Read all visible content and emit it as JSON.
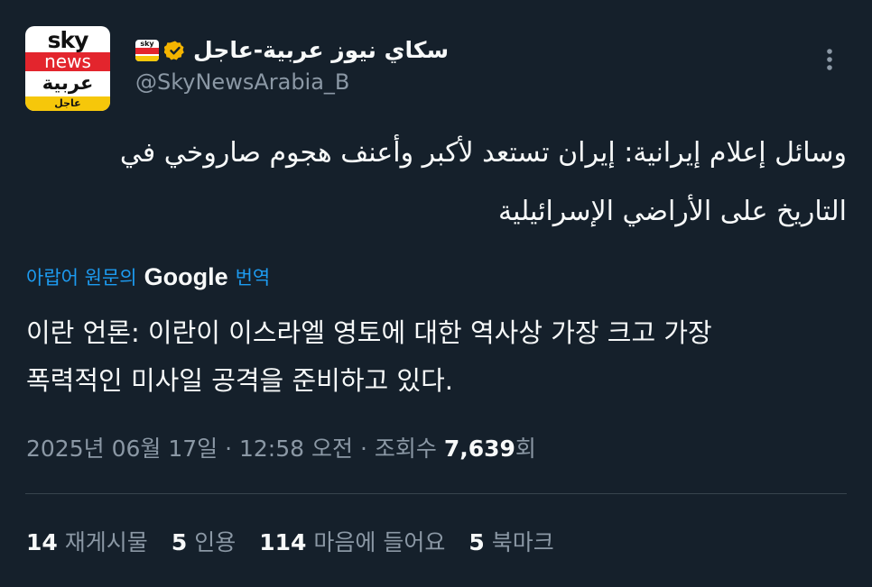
{
  "author": {
    "display_name": "سكاي نيوز عربية-عاجل",
    "handle": "@SkyNewsArabia_B",
    "avatar": {
      "sky": "sky",
      "news": "news",
      "arabic": "عربية",
      "urgent": "عاجل"
    },
    "badge_mini": "sky",
    "verified_icon": "verified-gold-badge-icon",
    "colors": {
      "verified": "#f4b400",
      "brand_red": "#e3252d",
      "brand_yellow": "#f6c70a"
    }
  },
  "more_icon": "more-vertical-icon",
  "tweet": {
    "text_line1": "وسائل إعلام إيرانية: إيران تستعد لأكبر وأعنف هجوم صاروخي في",
    "text_line2": "التاريخ على الأراضي الإسرائيلية",
    "translation_prefix": "아랍어 원문의",
    "translation_provider": "Google",
    "translation_suffix": "번역",
    "translated_line1": "이란 언론: 이란이 이스라엘 영토에 대한 역사상 가장 크고 가장",
    "translated_line2": "폭력적인 미사일 공격을 준비하고 있다."
  },
  "meta": {
    "date": "2025년 06월 17일",
    "sep1": "·",
    "time": "12:58 오전",
    "sep2": "·",
    "views_label": "조회수",
    "views_count": "7,639",
    "views_suffix": "회"
  },
  "stats": [
    {
      "count": "14",
      "label": "재게시물"
    },
    {
      "count": "5",
      "label": "인용"
    },
    {
      "count": "114",
      "label": "마음에 들어요"
    },
    {
      "count": "5",
      "label": "북마크"
    }
  ],
  "theme": {
    "background": "#15202b",
    "text": "#f7f9f9",
    "muted": "#8b98a5",
    "link": "#1d9bf0"
  }
}
